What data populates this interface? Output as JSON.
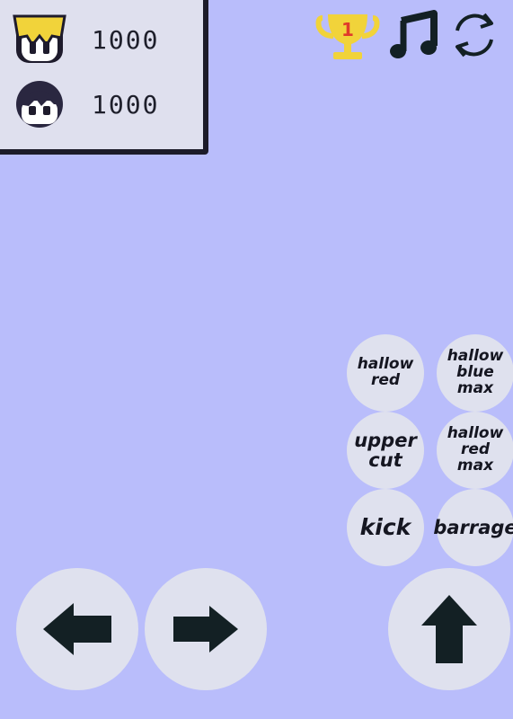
{
  "players": [
    {
      "name": "player-blonde",
      "hp": "1000",
      "hair_color": "#f1d33a"
    },
    {
      "name": "player-dark",
      "hp": "1000",
      "hair_color": "#2a2740"
    }
  ],
  "top_icons": {
    "trophy": {
      "icon": "trophy-icon",
      "count": "1",
      "color": "#f1d33a"
    },
    "music": {
      "icon": "music-note-icon"
    },
    "restart": {
      "icon": "refresh-icon"
    }
  },
  "moves": {
    "hallow_red": "hallow\nred",
    "hallow_blue_max": "hallow\nblue\nmax",
    "upper_cut": "upper\ncut",
    "hallow_red_max": "hallow\nred\nmax",
    "kick": "kick",
    "barrage": "barrage"
  },
  "controls": {
    "left": "arrow-left-icon",
    "right": "arrow-right-icon",
    "jump": "arrow-up-icon"
  },
  "colors": {
    "background": "#b9bdfb",
    "button": "#dfe1ee",
    "ink": "#151621"
  }
}
